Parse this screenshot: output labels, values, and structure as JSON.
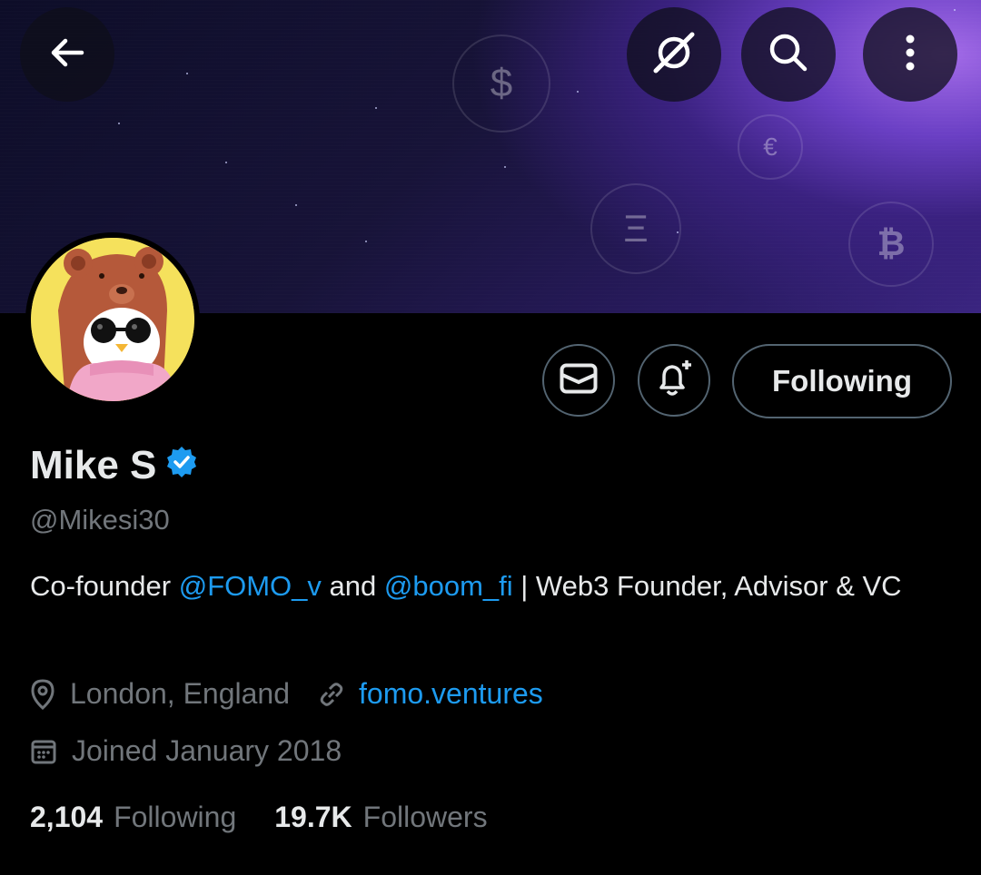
{
  "header": {
    "back_icon": "arrow-left-icon",
    "grok_icon": "grok-icon",
    "search_icon": "search-icon",
    "more_icon": "more-vertical-icon"
  },
  "banner": {
    "coins": [
      "$",
      "€",
      "Ξ",
      "₿"
    ]
  },
  "profile": {
    "name": "Mike S",
    "verified": true,
    "handle": "@Mikesi30",
    "bio_prefix": "Co-founder ",
    "bio_mention_1": "@FOMO_v",
    "bio_mid": " and ",
    "bio_mention_2": "@boom_fi",
    "bio_suffix": " | Web3 Founder, Advisor & VC",
    "location": "London, England",
    "website": "fomo.ventures",
    "joined": "Joined January 2018"
  },
  "actions": {
    "follow_label": "Following"
  },
  "stats": {
    "following_count": "2,104",
    "following_label": "Following",
    "followers_count": "19.7K",
    "followers_label": "Followers"
  },
  "colors": {
    "accent": "#1d9bf0",
    "muted": "#71767b",
    "text": "#e7e9ea",
    "background": "#000000"
  }
}
